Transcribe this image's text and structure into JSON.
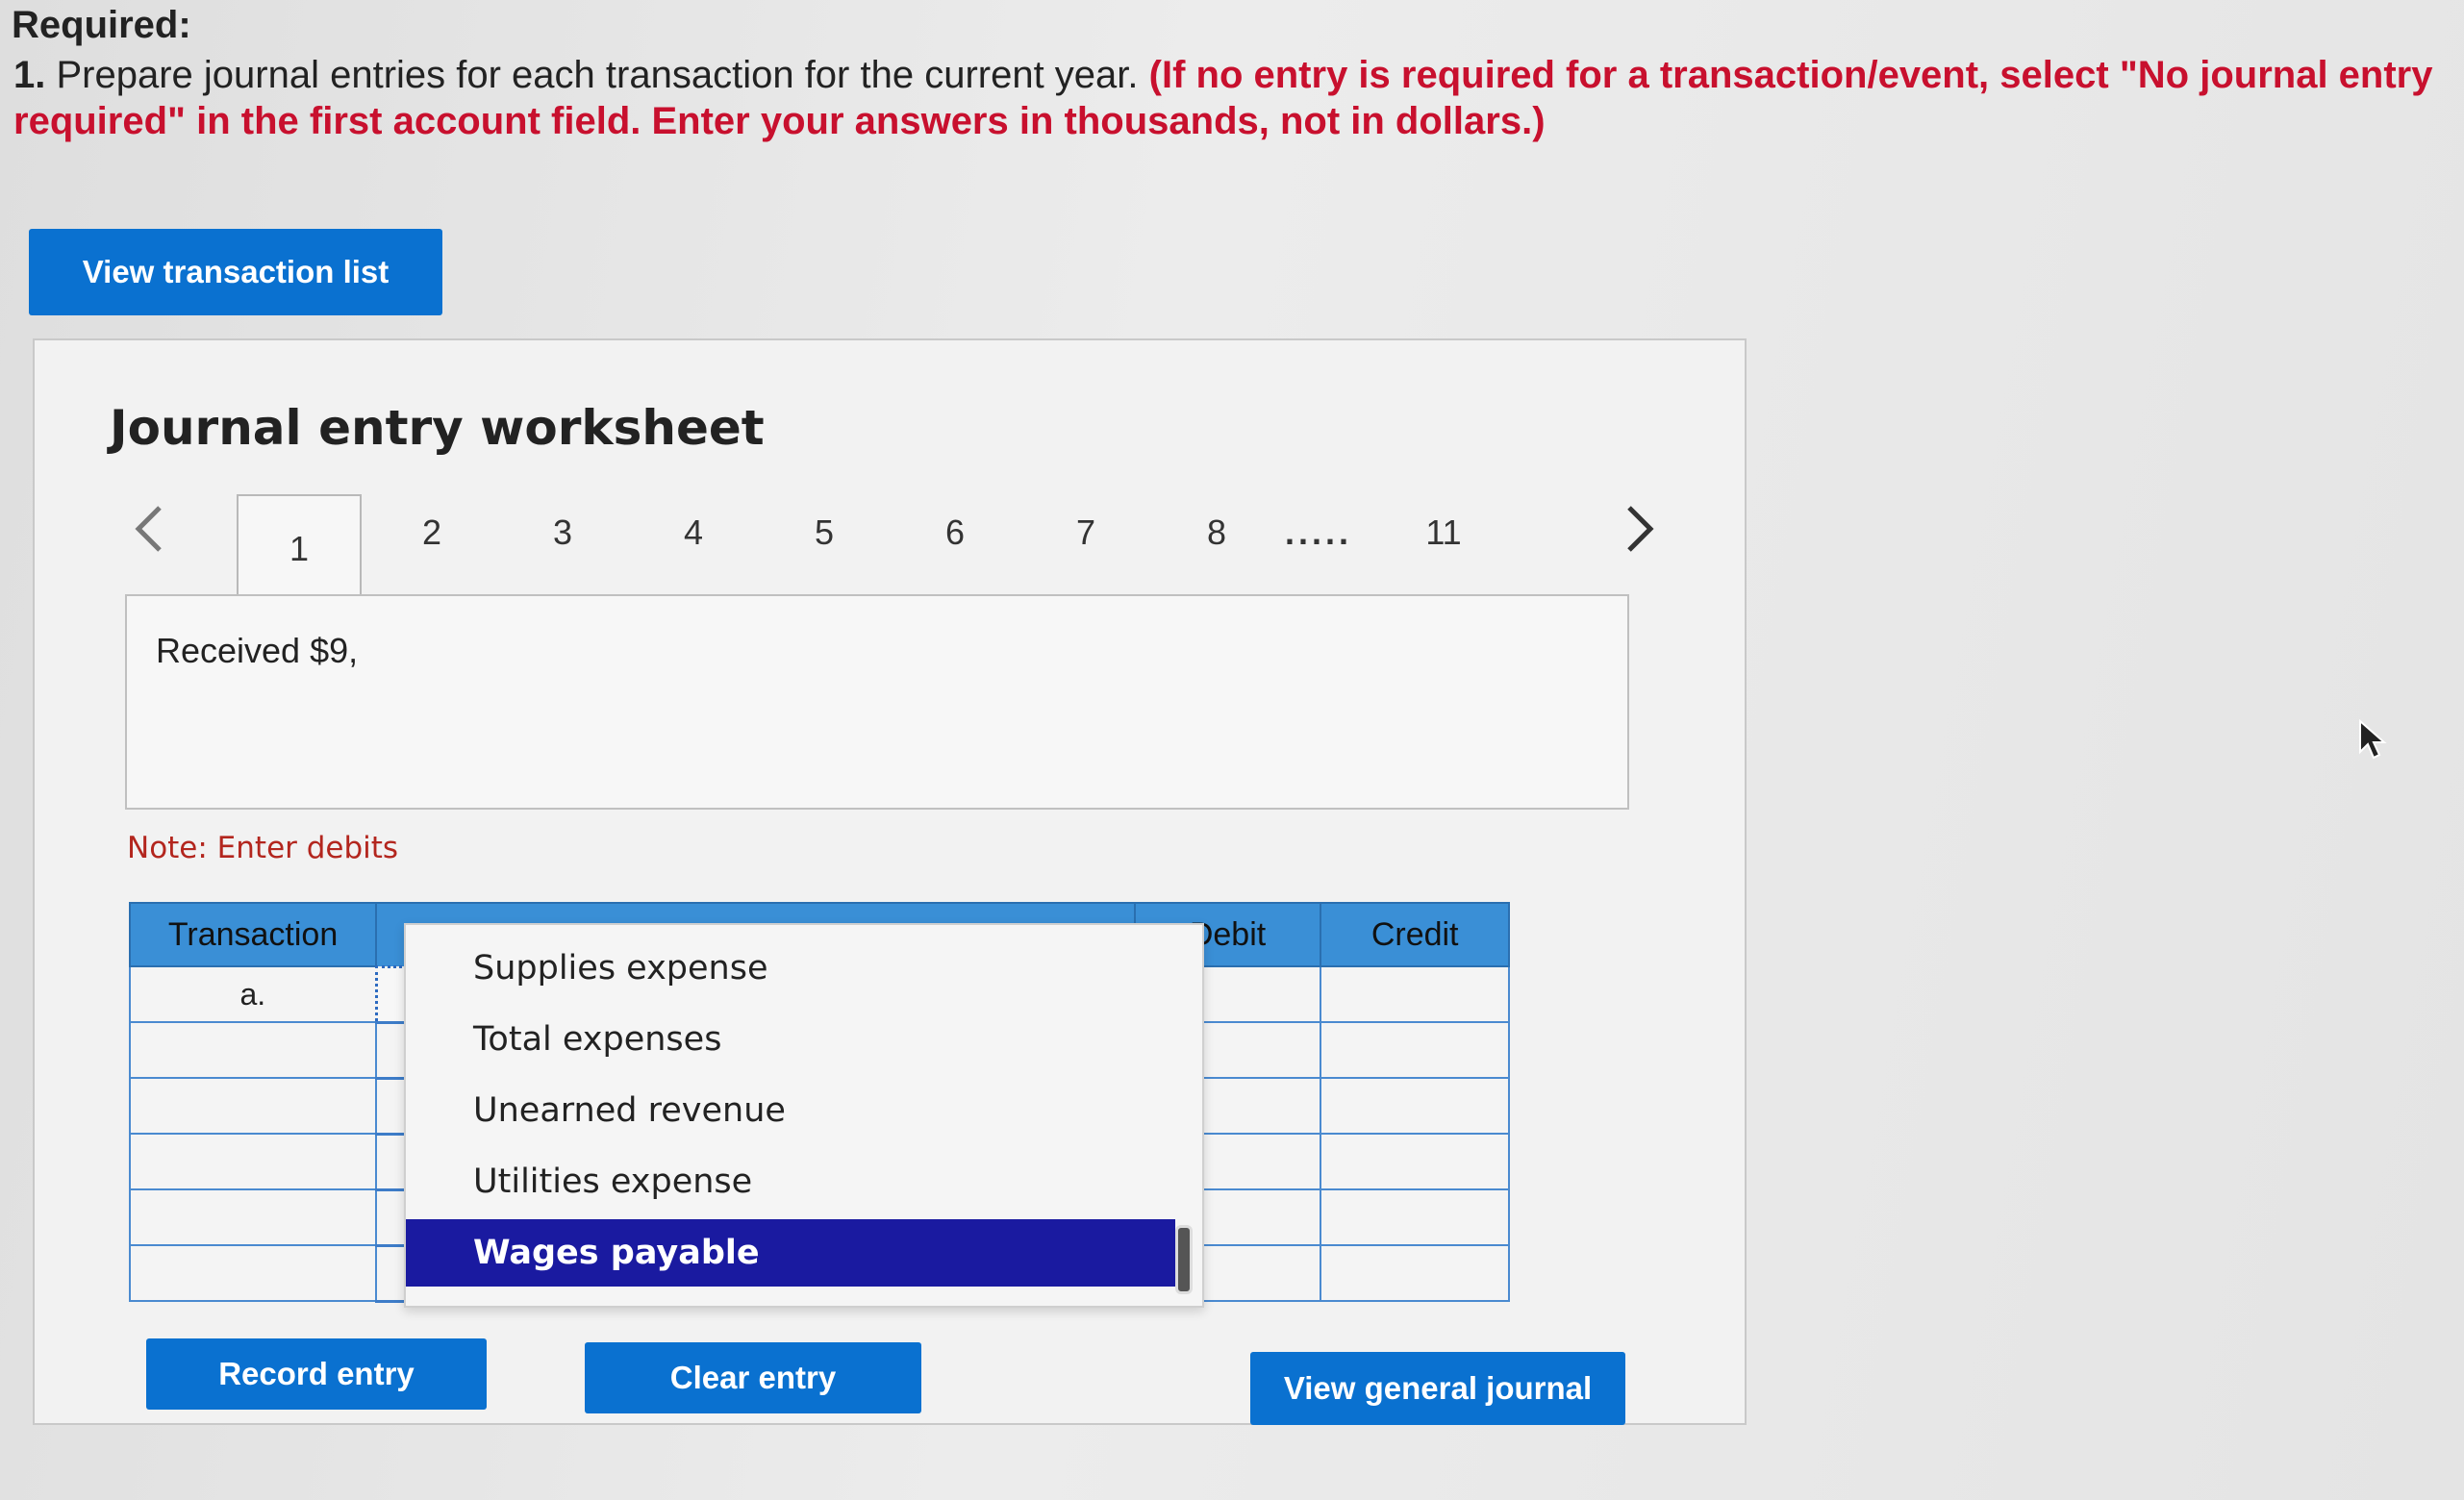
{
  "required": {
    "title": "Required:",
    "number": "1.",
    "text": "Prepare journal entries for each transaction for the current year.",
    "note_red": "(If no entry is required for a transaction/event, select \"No journal entry required\" in the first account field. Enter your answers in thousands, not in dollars.)"
  },
  "buttons": {
    "view_transaction_list": "View transaction list",
    "record_entry": "Record entry",
    "clear_entry": "Clear entry",
    "view_general_journal": "View general journal"
  },
  "worksheet": {
    "title": "Journal entry worksheet",
    "tabs": [
      "1",
      "2",
      "3",
      "4",
      "5",
      "6",
      "7",
      "8",
      ".....",
      "11"
    ],
    "active_tab": "1",
    "description": "Received $9,",
    "note": "Note: Enter debits"
  },
  "table": {
    "headers": {
      "transaction": "Transaction",
      "debit": "Debit",
      "credit": "Credit"
    },
    "rows": [
      {
        "transaction": "a."
      },
      {
        "transaction": ""
      },
      {
        "transaction": ""
      },
      {
        "transaction": ""
      },
      {
        "transaction": ""
      },
      {
        "transaction": ""
      }
    ]
  },
  "dropdown": {
    "items": [
      "Supplies expense",
      "Total expenses",
      "Unearned revenue",
      "Utilities expense",
      "Wages payable"
    ],
    "selected": "Wages payable"
  },
  "colors": {
    "primary_button": "#0a71d0",
    "instruction_red": "#c8102e",
    "selected_item": "#1a1aa0"
  }
}
